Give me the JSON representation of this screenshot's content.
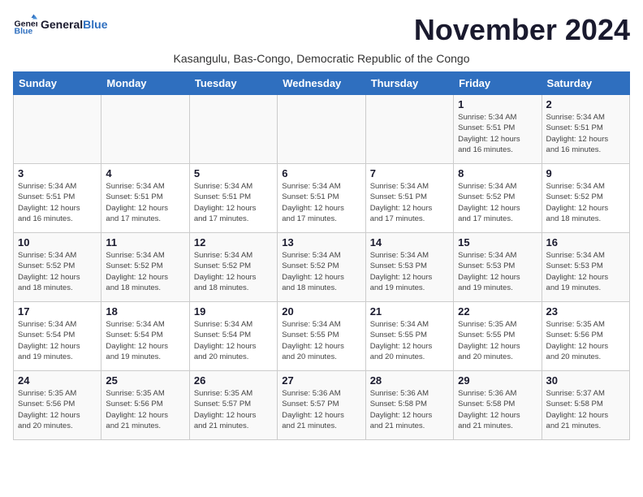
{
  "logo": {
    "text_general": "General",
    "text_blue": "Blue"
  },
  "title": "November 2024",
  "subtitle": "Kasangulu, Bas-Congo, Democratic Republic of the Congo",
  "days_of_week": [
    "Sunday",
    "Monday",
    "Tuesday",
    "Wednesday",
    "Thursday",
    "Friday",
    "Saturday"
  ],
  "weeks": [
    [
      {
        "day": "",
        "info": ""
      },
      {
        "day": "",
        "info": ""
      },
      {
        "day": "",
        "info": ""
      },
      {
        "day": "",
        "info": ""
      },
      {
        "day": "",
        "info": ""
      },
      {
        "day": "1",
        "info": "Sunrise: 5:34 AM\nSunset: 5:51 PM\nDaylight: 12 hours\nand 16 minutes."
      },
      {
        "day": "2",
        "info": "Sunrise: 5:34 AM\nSunset: 5:51 PM\nDaylight: 12 hours\nand 16 minutes."
      }
    ],
    [
      {
        "day": "3",
        "info": "Sunrise: 5:34 AM\nSunset: 5:51 PM\nDaylight: 12 hours\nand 16 minutes."
      },
      {
        "day": "4",
        "info": "Sunrise: 5:34 AM\nSunset: 5:51 PM\nDaylight: 12 hours\nand 17 minutes."
      },
      {
        "day": "5",
        "info": "Sunrise: 5:34 AM\nSunset: 5:51 PM\nDaylight: 12 hours\nand 17 minutes."
      },
      {
        "day": "6",
        "info": "Sunrise: 5:34 AM\nSunset: 5:51 PM\nDaylight: 12 hours\nand 17 minutes."
      },
      {
        "day": "7",
        "info": "Sunrise: 5:34 AM\nSunset: 5:51 PM\nDaylight: 12 hours\nand 17 minutes."
      },
      {
        "day": "8",
        "info": "Sunrise: 5:34 AM\nSunset: 5:52 PM\nDaylight: 12 hours\nand 17 minutes."
      },
      {
        "day": "9",
        "info": "Sunrise: 5:34 AM\nSunset: 5:52 PM\nDaylight: 12 hours\nand 18 minutes."
      }
    ],
    [
      {
        "day": "10",
        "info": "Sunrise: 5:34 AM\nSunset: 5:52 PM\nDaylight: 12 hours\nand 18 minutes."
      },
      {
        "day": "11",
        "info": "Sunrise: 5:34 AM\nSunset: 5:52 PM\nDaylight: 12 hours\nand 18 minutes."
      },
      {
        "day": "12",
        "info": "Sunrise: 5:34 AM\nSunset: 5:52 PM\nDaylight: 12 hours\nand 18 minutes."
      },
      {
        "day": "13",
        "info": "Sunrise: 5:34 AM\nSunset: 5:52 PM\nDaylight: 12 hours\nand 18 minutes."
      },
      {
        "day": "14",
        "info": "Sunrise: 5:34 AM\nSunset: 5:53 PM\nDaylight: 12 hours\nand 19 minutes."
      },
      {
        "day": "15",
        "info": "Sunrise: 5:34 AM\nSunset: 5:53 PM\nDaylight: 12 hours\nand 19 minutes."
      },
      {
        "day": "16",
        "info": "Sunrise: 5:34 AM\nSunset: 5:53 PM\nDaylight: 12 hours\nand 19 minutes."
      }
    ],
    [
      {
        "day": "17",
        "info": "Sunrise: 5:34 AM\nSunset: 5:54 PM\nDaylight: 12 hours\nand 19 minutes."
      },
      {
        "day": "18",
        "info": "Sunrise: 5:34 AM\nSunset: 5:54 PM\nDaylight: 12 hours\nand 19 minutes."
      },
      {
        "day": "19",
        "info": "Sunrise: 5:34 AM\nSunset: 5:54 PM\nDaylight: 12 hours\nand 20 minutes."
      },
      {
        "day": "20",
        "info": "Sunrise: 5:34 AM\nSunset: 5:55 PM\nDaylight: 12 hours\nand 20 minutes."
      },
      {
        "day": "21",
        "info": "Sunrise: 5:34 AM\nSunset: 5:55 PM\nDaylight: 12 hours\nand 20 minutes."
      },
      {
        "day": "22",
        "info": "Sunrise: 5:35 AM\nSunset: 5:55 PM\nDaylight: 12 hours\nand 20 minutes."
      },
      {
        "day": "23",
        "info": "Sunrise: 5:35 AM\nSunset: 5:56 PM\nDaylight: 12 hours\nand 20 minutes."
      }
    ],
    [
      {
        "day": "24",
        "info": "Sunrise: 5:35 AM\nSunset: 5:56 PM\nDaylight: 12 hours\nand 20 minutes."
      },
      {
        "day": "25",
        "info": "Sunrise: 5:35 AM\nSunset: 5:56 PM\nDaylight: 12 hours\nand 21 minutes."
      },
      {
        "day": "26",
        "info": "Sunrise: 5:35 AM\nSunset: 5:57 PM\nDaylight: 12 hours\nand 21 minutes."
      },
      {
        "day": "27",
        "info": "Sunrise: 5:36 AM\nSunset: 5:57 PM\nDaylight: 12 hours\nand 21 minutes."
      },
      {
        "day": "28",
        "info": "Sunrise: 5:36 AM\nSunset: 5:58 PM\nDaylight: 12 hours\nand 21 minutes."
      },
      {
        "day": "29",
        "info": "Sunrise: 5:36 AM\nSunset: 5:58 PM\nDaylight: 12 hours\nand 21 minutes."
      },
      {
        "day": "30",
        "info": "Sunrise: 5:37 AM\nSunset: 5:58 PM\nDaylight: 12 hours\nand 21 minutes."
      }
    ]
  ]
}
